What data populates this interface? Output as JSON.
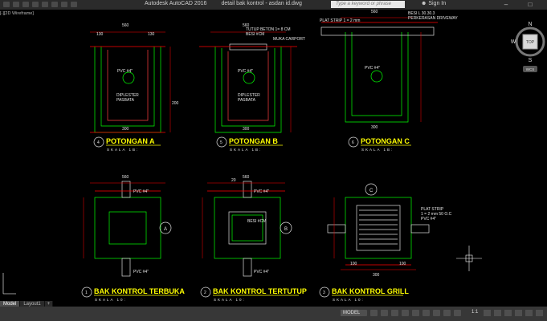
{
  "app": {
    "title": "Autodesk AutoCAD 2016",
    "document": "detail bak kontrol - asdan id.dwg",
    "search_placeholder": "Type a keyword or phrase",
    "sign_in": "Sign In",
    "view_label": "[-][2D Wireframe]"
  },
  "navcube": {
    "north": "N",
    "south": "S",
    "west": "W",
    "top": "TOP",
    "wcs": "WCS"
  },
  "tabs": [
    {
      "label": "Model",
      "active": true
    },
    {
      "label": "Layout1",
      "active": false
    },
    {
      "label": "+",
      "active": false
    }
  ],
  "statusbar": {
    "model_label": "MODEL",
    "scale": "1:1"
  },
  "drawing": {
    "sections": [
      {
        "num": "4",
        "title": "POTONGAN A",
        "scale": "SKALA 1B:",
        "circle": "4"
      },
      {
        "num": "5",
        "title": "POTONGAN B",
        "scale": "SKALA 1B:",
        "circle": "5"
      },
      {
        "num": "6",
        "title": "POTONGAN C",
        "scale": "SKALA 1B:",
        "circle": "6"
      },
      {
        "num": "1",
        "title": "BAK KONTROL TERBUKA",
        "scale": "SKALA 10:",
        "circle": "1"
      },
      {
        "num": "2",
        "title": "BAK KONTROL TERTUTUP",
        "scale": "SKALA 10:",
        "circle": "2"
      },
      {
        "num": "3",
        "title": "BAK KONTROL GRILL",
        "scale": "SKALA 10:",
        "circle": "3"
      }
    ],
    "notes": {
      "pvc": "PVC #4\"",
      "diplester": "DIPLESTER",
      "pasbata": "PASBATA",
      "tutup_beton": "TUTUP BETON 1= 8 CM",
      "besi": "BESI #CM",
      "muka_carport": "MUKA CARPORT",
      "plat_strip": "PLAT STRIP 1 = 2 mm",
      "besi_l": "BESI L 30.30.3",
      "perkerasan": "PERKERASAN DRIVEWAY",
      "plat_strip2": "PLAT STRIP",
      "plat_strip2b": "1 = 2 mm 50 O.C",
      "marker_a": "A",
      "marker_b": "B",
      "marker_c": "C",
      "dim_560": "560",
      "dim_300": "300",
      "dim_130": "130",
      "dim_200": "200",
      "dim_100": "100",
      "dim_20": "20"
    }
  }
}
